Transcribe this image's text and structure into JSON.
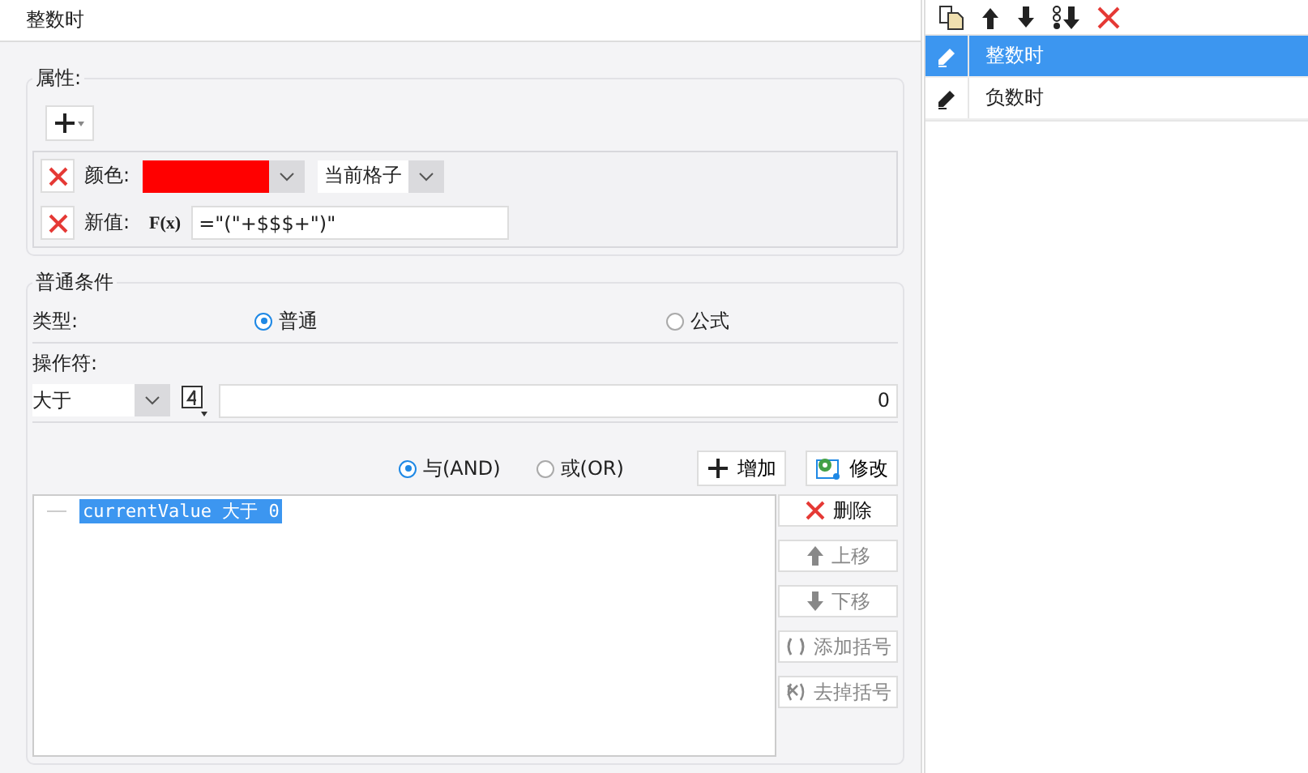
{
  "title": "整数时",
  "properties": {
    "legend": "属性:",
    "rows": [
      {
        "kind": "color",
        "label": "颜色:",
        "color": "#ff0000",
        "scope": "当前格子"
      },
      {
        "kind": "value",
        "label": "新值:",
        "formula_button": "F(x)",
        "formula": "=\"(\"+$$$+\")\""
      }
    ]
  },
  "condition": {
    "legend": "普通条件",
    "type_label": "类型:",
    "types": [
      {
        "label": "普通",
        "selected": true
      },
      {
        "label": "公式",
        "selected": false
      }
    ],
    "operator_label": "操作符:",
    "operator": "大于",
    "operand": "0",
    "logic": [
      {
        "label": "与(AND)",
        "selected": true
      },
      {
        "label": "或(OR)",
        "selected": false
      }
    ],
    "add": "增加",
    "modify": "修改",
    "items": [
      {
        "text": "currentValue 大于 0",
        "selected": true
      }
    ],
    "actions": [
      {
        "label": "删除",
        "kind": "delete",
        "disabled": false
      },
      {
        "label": "上移",
        "kind": "up",
        "disabled": true
      },
      {
        "label": "下移",
        "kind": "down",
        "disabled": true
      },
      {
        "label": "添加括号",
        "kind": "brackets",
        "disabled": true
      },
      {
        "label": "去掉括号",
        "kind": "unbrackets",
        "disabled": true
      }
    ]
  },
  "rules": [
    {
      "label": "整数时",
      "selected": true
    },
    {
      "label": "负数时",
      "selected": false
    }
  ]
}
